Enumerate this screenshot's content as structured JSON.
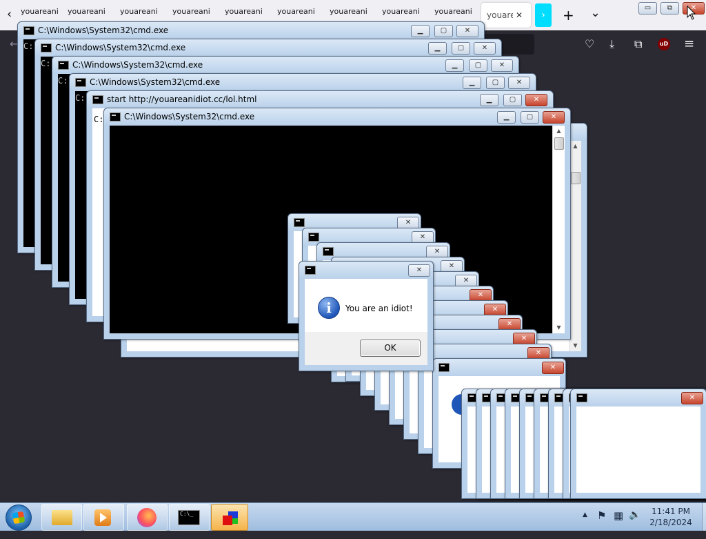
{
  "browser": {
    "tabs": [
      "youareani",
      "youareani",
      "youareani",
      "youareani",
      "youareani",
      "youareani",
      "youareani",
      "youareani",
      "youareani"
    ],
    "active_tab": {
      "label": "youareani",
      "close": "✕"
    },
    "glyphs": {
      "back": "‹",
      "new_tab": "+",
      "tab_list": "⌄",
      "nav_back": "←",
      "pocket": "♡",
      "download": "⤓",
      "extensions": "⧉",
      "ublock": "uD",
      "menu": "≡",
      "next_tab": "›"
    },
    "colors": {
      "tabbar": "#f0f0f4",
      "toolbar": "#2b2a33",
      "accent": "#00ddff"
    }
  },
  "host_window_controls": {
    "minimize": "▭",
    "restore": "⧉",
    "close": "✕"
  },
  "cmd_windows": [
    {
      "title": "C:\\Windows\\System32\\cmd.exe",
      "prompt": "C:"
    },
    {
      "title": "C:\\Windows\\System32\\cmd.exe",
      "prompt": "C:"
    },
    {
      "title": "C:\\Windows\\System32\\cmd.exe",
      "prompt": "C:"
    },
    {
      "title": "C:\\Windows\\System32\\cmd.exe",
      "prompt": "C:"
    },
    {
      "title": "start  http://youareanidiot.cc/lol.html",
      "prompt": "C:"
    },
    {
      "title": "C:\\Windows\\System32\\cmd.exe",
      "prompt": ""
    }
  ],
  "caption_glyphs": {
    "min": "▁",
    "max": "▢",
    "close": "✕"
  },
  "message_box": {
    "text": "You are an idiot!",
    "ok": "OK",
    "icon": "i"
  },
  "taskbar": {
    "pinned": [
      "windows-explorer-icon",
      "media-player-icon",
      "firefox-icon",
      "cmd-icon",
      "cube-app-icon"
    ],
    "cmd_icon_text": "C:\\_",
    "tray": {
      "show_hidden": "▲",
      "flag": "⚑",
      "network": "▦",
      "volume": "🔈"
    },
    "time": "11:41 PM",
    "date": "2/18/2024"
  }
}
